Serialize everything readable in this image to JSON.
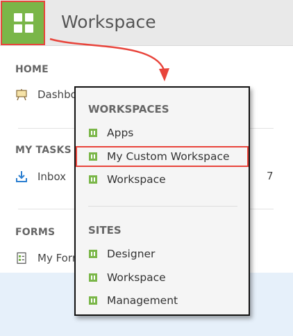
{
  "header": {
    "title": "Workspace",
    "app_button_icon": "grid-icon"
  },
  "sidebar": {
    "home": {
      "title": "HOME",
      "items": [
        {
          "label": "Dashboard",
          "icon": "easel-icon"
        }
      ]
    },
    "tasks": {
      "title": "MY TASKS",
      "items": [
        {
          "label": "Inbox",
          "icon": "download-inbox-icon",
          "count": "7"
        }
      ]
    },
    "forms": {
      "title": "FORMS",
      "items": [
        {
          "label": "My Forms",
          "icon": "form-icon"
        }
      ]
    }
  },
  "dropdown": {
    "workspaces_title": "WORKSPACES",
    "workspaces": [
      {
        "label": "Apps",
        "icon": "workspace-icon"
      },
      {
        "label": "My Custom Workspace",
        "icon": "workspace-icon",
        "highlighted": true
      },
      {
        "label": "Workspace",
        "icon": "workspace-icon"
      }
    ],
    "sites_title": "SITES",
    "sites": [
      {
        "label": "Designer",
        "icon": "workspace-icon"
      },
      {
        "label": "Workspace",
        "icon": "workspace-icon"
      },
      {
        "label": "Management",
        "icon": "workspace-icon"
      }
    ]
  },
  "colors": {
    "accent_green": "#7ab648",
    "highlight_red": "#e8443b",
    "header_bg": "#e9e9e9",
    "bottom_band": "#e6f0fa"
  }
}
